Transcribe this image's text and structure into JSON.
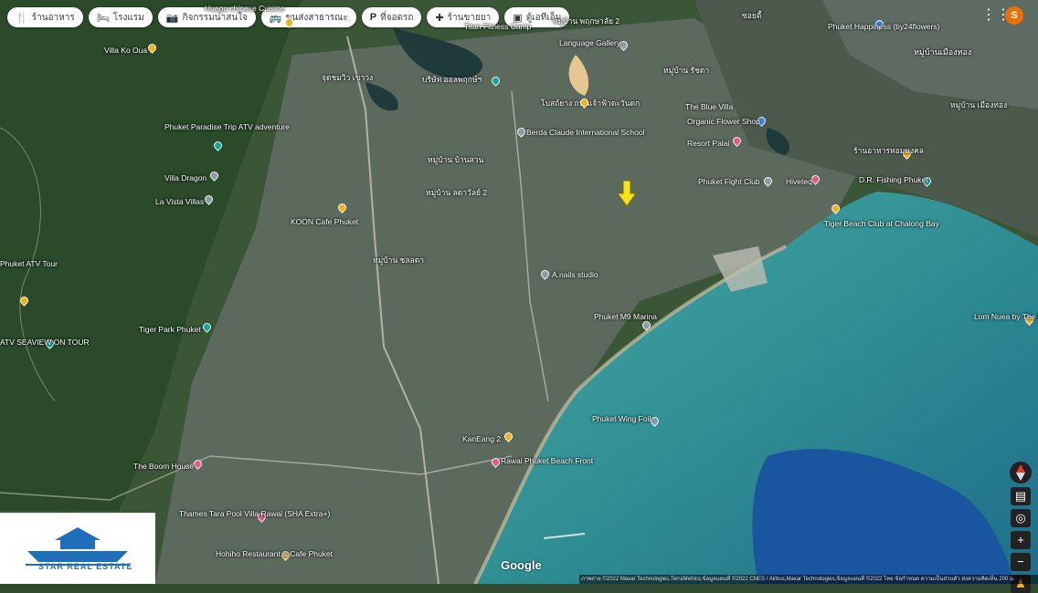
{
  "top_chips": [
    {
      "icon": "restaurant-icon",
      "label": "ร้านอาหาร"
    },
    {
      "icon": "hotel-icon",
      "label": "โรงแรม"
    },
    {
      "icon": "camera-icon",
      "label": "กิจกรรมน่าสนใจ"
    },
    {
      "icon": "transit-icon",
      "label": "ขนส่งสาธารณะ"
    },
    {
      "icon": "parking-icon",
      "label": "ที่จอดรถ"
    },
    {
      "icon": "pharmacy-icon",
      "label": "ร้านขายยา"
    },
    {
      "icon": "atm-icon",
      "label": "ตู้เอทีเอ็ม"
    }
  ],
  "account_initial": "S",
  "places": [
    {
      "name": "Villa Ko Oua",
      "pin": "yellow"
    },
    {
      "name": "Huagu chinese Cuisine",
      "pin": "yellow"
    },
    {
      "name": "Titan Fitness Camp",
      "pin": ""
    },
    {
      "name": "หมู่บ้าน พฤกษาลัย 2",
      "pin": ""
    },
    {
      "name": "Language Gallery",
      "pin": "grey"
    },
    {
      "name": "Phuket Happiness (by24flowers)",
      "pin": "blue"
    },
    {
      "name": "หมู่บ้านเมืองทอง",
      "pin": ""
    },
    {
      "name": "ซอยตี้",
      "pin": ""
    },
    {
      "name": "หมู่บ้าน รัชดา",
      "pin": ""
    },
    {
      "name": "จุดชมวิว เขาวง",
      "pin": ""
    },
    {
      "name": "บริษัท ออลพฤกษ์ฯ",
      "pin": "teal"
    },
    {
      "name": "โบสถ์ยาง ถนนเจ้าฟ้าตะวันตก",
      "pin": ""
    },
    {
      "name": "The Blue Villa",
      "pin": "yellow"
    },
    {
      "name": "หมู่บ้าน เมืองทอง",
      "pin": ""
    },
    {
      "name": "Phuket Paradise Trip ATV adventure",
      "pin": "teal"
    },
    {
      "name": "Berda Claude International School",
      "pin": "grey"
    },
    {
      "name": "Organic Flower Shop",
      "pin": "blue"
    },
    {
      "name": "Resort Palai",
      "pin": "pink"
    },
    {
      "name": "ร้านอาหารหอมมงคล",
      "pin": "yellow"
    },
    {
      "name": "Villa Dragon",
      "pin": "grey"
    },
    {
      "name": "หมู่บ้าน บ้านสวน",
      "pin": ""
    },
    {
      "name": "Phuket Fight Club",
      "pin": "grey"
    },
    {
      "name": "Hiveteq",
      "pin": "pink"
    },
    {
      "name": "D.R. Fishing Phuket",
      "pin": "teal"
    },
    {
      "name": "La Vista Villas",
      "pin": "grey"
    },
    {
      "name": "หมู่บ้าน ลดาวัลย์ 2",
      "pin": ""
    },
    {
      "name": "KOON Cafe Phuket",
      "pin": "yellow"
    },
    {
      "name": "Tiger Beach Club at Chalong Bay",
      "pin": "yellow"
    },
    {
      "name": "Phuket ATV Tour",
      "pin": "yellow"
    },
    {
      "name": "หมู่บ้าน ชลลดา",
      "pin": ""
    },
    {
      "name": "A.nails studio",
      "pin": "grey"
    },
    {
      "name": "Phuket M9 Marina",
      "pin": "grey"
    },
    {
      "name": "Lom Nuea by The Beach Bar",
      "pin": "yellow"
    },
    {
      "name": "Tiger Park Phuket",
      "pin": "teal"
    },
    {
      "name": "ATV SEAVIEW ON TOUR",
      "pin": "teal"
    },
    {
      "name": "Phuket Wing Foil",
      "pin": "grey"
    },
    {
      "name": "The Boom House",
      "pin": "pink"
    },
    {
      "name": "KanEang 2",
      "pin": "yellow"
    },
    {
      "name": "Rawai Phuket Beach Front",
      "pin": "pink"
    },
    {
      "name": "Thames Tara Pool Villa Rawai (SHA Extra+)",
      "pin": "pink"
    },
    {
      "name": "Hohiho Restaurant & Cafe Phuket",
      "pin": "yellow"
    }
  ],
  "brand": "STAR REAL ESTATE",
  "google_logo": "Google",
  "attribution": "ภาพถ่าย ©2022 Maxar Technologies,TerraMetrics,ข้อมูลแผนที่ ©2022 CNES / Airbus,Maxar Technologies,ข้อมูลแผนที่ ©2022   ไทย   ข้อกำหนด   ความเป็นส่วนตัว   ส่งความคิดเห็น   200 ม."
}
